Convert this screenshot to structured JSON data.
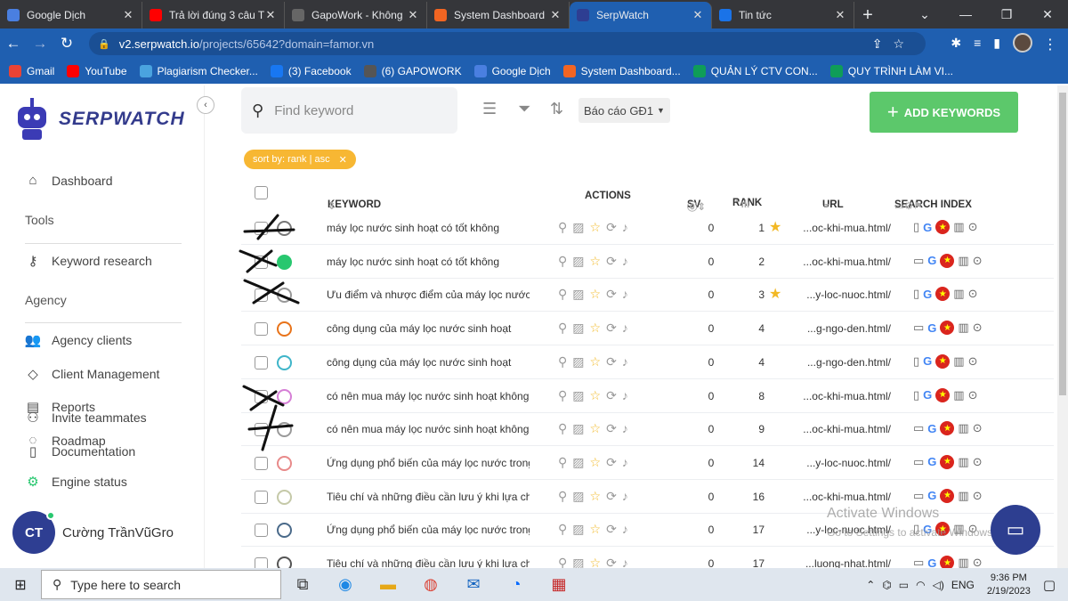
{
  "browser": {
    "tabs": [
      {
        "title": "Google Dịch",
        "color": "#4a7fe0"
      },
      {
        "title": "Trả lời đúng 3 câu T",
        "color": "#ff0000"
      },
      {
        "title": "GapoWork - Không",
        "color": "#666666"
      },
      {
        "title": "System Dashboard",
        "color": "#f26522"
      },
      {
        "title": "SerpWatch",
        "color": "#2e3e92",
        "active": true
      },
      {
        "title": "Tin tức",
        "color": "#1a73e8"
      }
    ],
    "new_tab": "+",
    "address": {
      "host": "v2.serpwatch.io",
      "path": "/projects/65642?domain=famor.vn"
    },
    "bookmarks": [
      {
        "label": "Gmail",
        "color": "#ea4335"
      },
      {
        "label": "YouTube",
        "color": "#ff0000"
      },
      {
        "label": "Plagiarism Checker...",
        "color": "#4aa3df"
      },
      {
        "label": "(3) Facebook",
        "color": "#1877f2"
      },
      {
        "label": "(6) GAPOWORK",
        "color": "#555555"
      },
      {
        "label": "Google Dịch",
        "color": "#4a7fe0"
      },
      {
        "label": "System Dashboard...",
        "color": "#f26522"
      },
      {
        "label": "QUẢN LÝ CTV CON...",
        "color": "#0f9d58"
      },
      {
        "label": "QUY TRÌNH LÀM VI...",
        "color": "#0f9d58"
      }
    ]
  },
  "sidebar": {
    "brand": "SERPWATCH",
    "dashboard": "Dashboard",
    "tools_heading": "Tools",
    "keyword_research": "Keyword research",
    "agency_heading": "Agency",
    "agency_clients": "Agency clients",
    "client_management": "Client Management",
    "reports": "Reports",
    "invite_teammates": "Invite teammates",
    "roadmap": "Roadmap",
    "documentation": "Documentation",
    "engine_status": "Engine status",
    "user_initials": "CT",
    "user_name": "Cường TrầnVũGro"
  },
  "toolbar": {
    "search_placeholder": "Find keyword",
    "report_select": "Báo cáo GĐ1",
    "add_keywords": "ADD KEYWORDS",
    "sort_chip": "sort by: rank | asc"
  },
  "table": {
    "headers": {
      "keyword": "KEYWORD",
      "actions": "ACTIONS",
      "sv": "SV",
      "rank": "RANK",
      "url": "URL",
      "search_index": "SEARCH INDEX"
    },
    "rows": [
      {
        "keyword": "máy lọc nước sinh hoạt có tốt không",
        "sv": "0",
        "rank": "1",
        "star": true,
        "url": "...oc-khi-mua.html/",
        "circle": "#777777",
        "device": "mobile"
      },
      {
        "keyword": "máy lọc nước sinh hoạt có tốt không",
        "sv": "0",
        "rank": "2",
        "star": false,
        "url": "...oc-khi-mua.html/",
        "circle": "#28c76f",
        "device": "desktop"
      },
      {
        "keyword": "Ưu điểm và nhược điểm của máy lọc nước g",
        "sv": "0",
        "rank": "3",
        "star": true,
        "url": "...y-loc-nuoc.html/",
        "circle": "#999999",
        "device": "mobile"
      },
      {
        "keyword": "công dụng của máy lọc nước sinh hoạt",
        "sv": "0",
        "rank": "4",
        "star": false,
        "url": "...g-ngo-den.html/",
        "circle": "#e8731a",
        "device": "desktop"
      },
      {
        "keyword": "công dụng của máy lọc nước sinh hoạt",
        "sv": "0",
        "rank": "4",
        "star": false,
        "url": "...g-ngo-den.html/",
        "circle": "#3fb5c9",
        "device": "mobile"
      },
      {
        "keyword": "có nên mua máy lọc nước sinh hoạt không",
        "sv": "0",
        "rank": "8",
        "star": false,
        "url": "...oc-khi-mua.html/",
        "circle": "#d67fd6",
        "device": "mobile"
      },
      {
        "keyword": "có nên mua máy lọc nước sinh hoạt không",
        "sv": "0",
        "rank": "9",
        "star": false,
        "url": "...oc-khi-mua.html/",
        "circle": "#999999",
        "device": "desktop"
      },
      {
        "keyword": "Ứng dụng phổ biến của máy lọc nước trong",
        "sv": "0",
        "rank": "14",
        "star": false,
        "url": "...y-loc-nuoc.html/",
        "circle": "#e88a8a",
        "device": "desktop"
      },
      {
        "keyword": "Tiêu chí và những điều cần lưu ý khi lựa chọ",
        "sv": "0",
        "rank": "16",
        "star": false,
        "url": "...oc-khi-mua.html/",
        "circle": "#c5c9a8",
        "device": "desktop"
      },
      {
        "keyword": "Ứng dụng phổ biến của máy lọc nước trong",
        "sv": "0",
        "rank": "17",
        "star": false,
        "url": "...y-loc-nuoc.html/",
        "circle": "#4a6a8a",
        "device": "mobile"
      },
      {
        "keyword": "Tiêu chí và những điều cần lưu ý khi lựa chọ",
        "sv": "0",
        "rank": "17",
        "star": false,
        "url": "...luong-nhat.html/",
        "circle": "#555555",
        "device": "desktop"
      }
    ]
  },
  "watermark": {
    "line1": "Activate Windows",
    "line2": "Go to Settings to activate Windows."
  },
  "taskbar": {
    "search_placeholder": "Type here to search",
    "lang": "ENG",
    "time": "9:36 PM",
    "date": "2/19/2023"
  }
}
